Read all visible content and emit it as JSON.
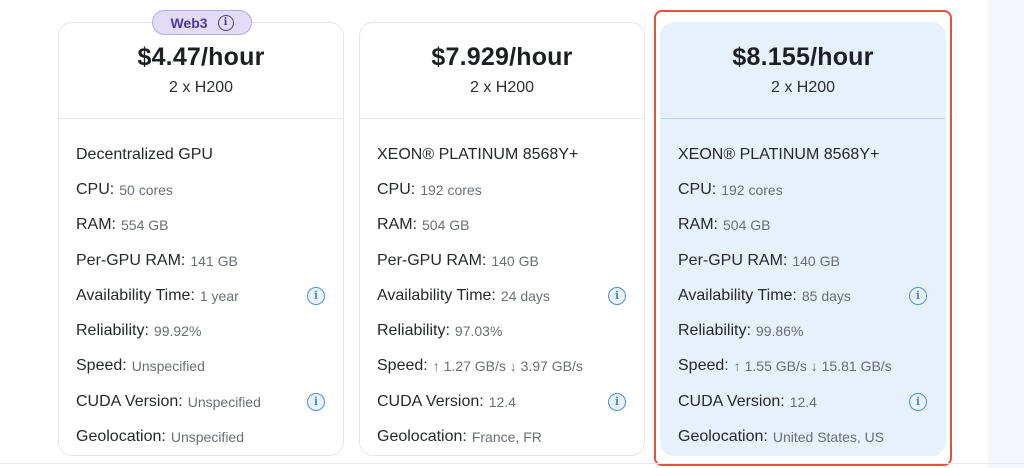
{
  "badge": {
    "label": "Web3",
    "icon": "info-icon"
  },
  "cards": [
    {
      "price": "$4.47/hour",
      "gpu": "2 x H200",
      "name": "Decentralized GPU",
      "specs": [
        {
          "key": "CPU:",
          "value": "50 cores",
          "info": false
        },
        {
          "key": "RAM:",
          "value": "554 GB",
          "info": false
        },
        {
          "key": "Per-GPU RAM:",
          "value": "141 GB",
          "info": false
        },
        {
          "key": "Availability Time:",
          "value": "1 year",
          "info": true
        },
        {
          "key": "Reliability:",
          "value": "99.92%",
          "info": false
        },
        {
          "key": "Speed:",
          "value": "Unspecified",
          "info": false
        },
        {
          "key": "CUDA Version:",
          "value": "Unspecified",
          "info": true
        },
        {
          "key": "Geolocation:",
          "value": "Unspecified",
          "info": false
        }
      ]
    },
    {
      "price": "$7.929/hour",
      "gpu": "2 x H200",
      "name": "XEON® PLATINUM 8568Y+",
      "specs": [
        {
          "key": "CPU:",
          "value": "192 cores",
          "info": false
        },
        {
          "key": "RAM:",
          "value": "504 GB",
          "info": false
        },
        {
          "key": "Per-GPU RAM:",
          "value": "140 GB",
          "info": false
        },
        {
          "key": "Availability Time:",
          "value": "24 days",
          "info": true
        },
        {
          "key": "Reliability:",
          "value": "97.03%",
          "info": false
        },
        {
          "key": "Speed:",
          "value": "↑ 1.27 GB/s ↓ 3.97 GB/s",
          "info": false
        },
        {
          "key": "CUDA Version:",
          "value": "12.4",
          "info": true
        },
        {
          "key": "Geolocation:",
          "value": "France, FR",
          "info": false
        }
      ]
    },
    {
      "price": "$8.155/hour",
      "gpu": "2 x H200",
      "name": "XEON® PLATINUM 8568Y+",
      "selected": true,
      "specs": [
        {
          "key": "CPU:",
          "value": "192 cores",
          "info": false
        },
        {
          "key": "RAM:",
          "value": "504 GB",
          "info": false
        },
        {
          "key": "Per-GPU RAM:",
          "value": "140 GB",
          "info": false
        },
        {
          "key": "Availability Time:",
          "value": "85 days",
          "info": true
        },
        {
          "key": "Reliability:",
          "value": "99.86%",
          "info": false
        },
        {
          "key": "Speed:",
          "value": "↑ 1.55 GB/s ↓ 15.81 GB/s",
          "info": false
        },
        {
          "key": "CUDA Version:",
          "value": "12.4",
          "info": true
        },
        {
          "key": "Geolocation:",
          "value": "United States, US",
          "info": false
        }
      ]
    }
  ],
  "colors": {
    "selected_bg": "#e7f1fc",
    "selected_ring": "#e0533d",
    "info_blue": "#4a90e2",
    "badge_purple": "#4d3aa8"
  }
}
